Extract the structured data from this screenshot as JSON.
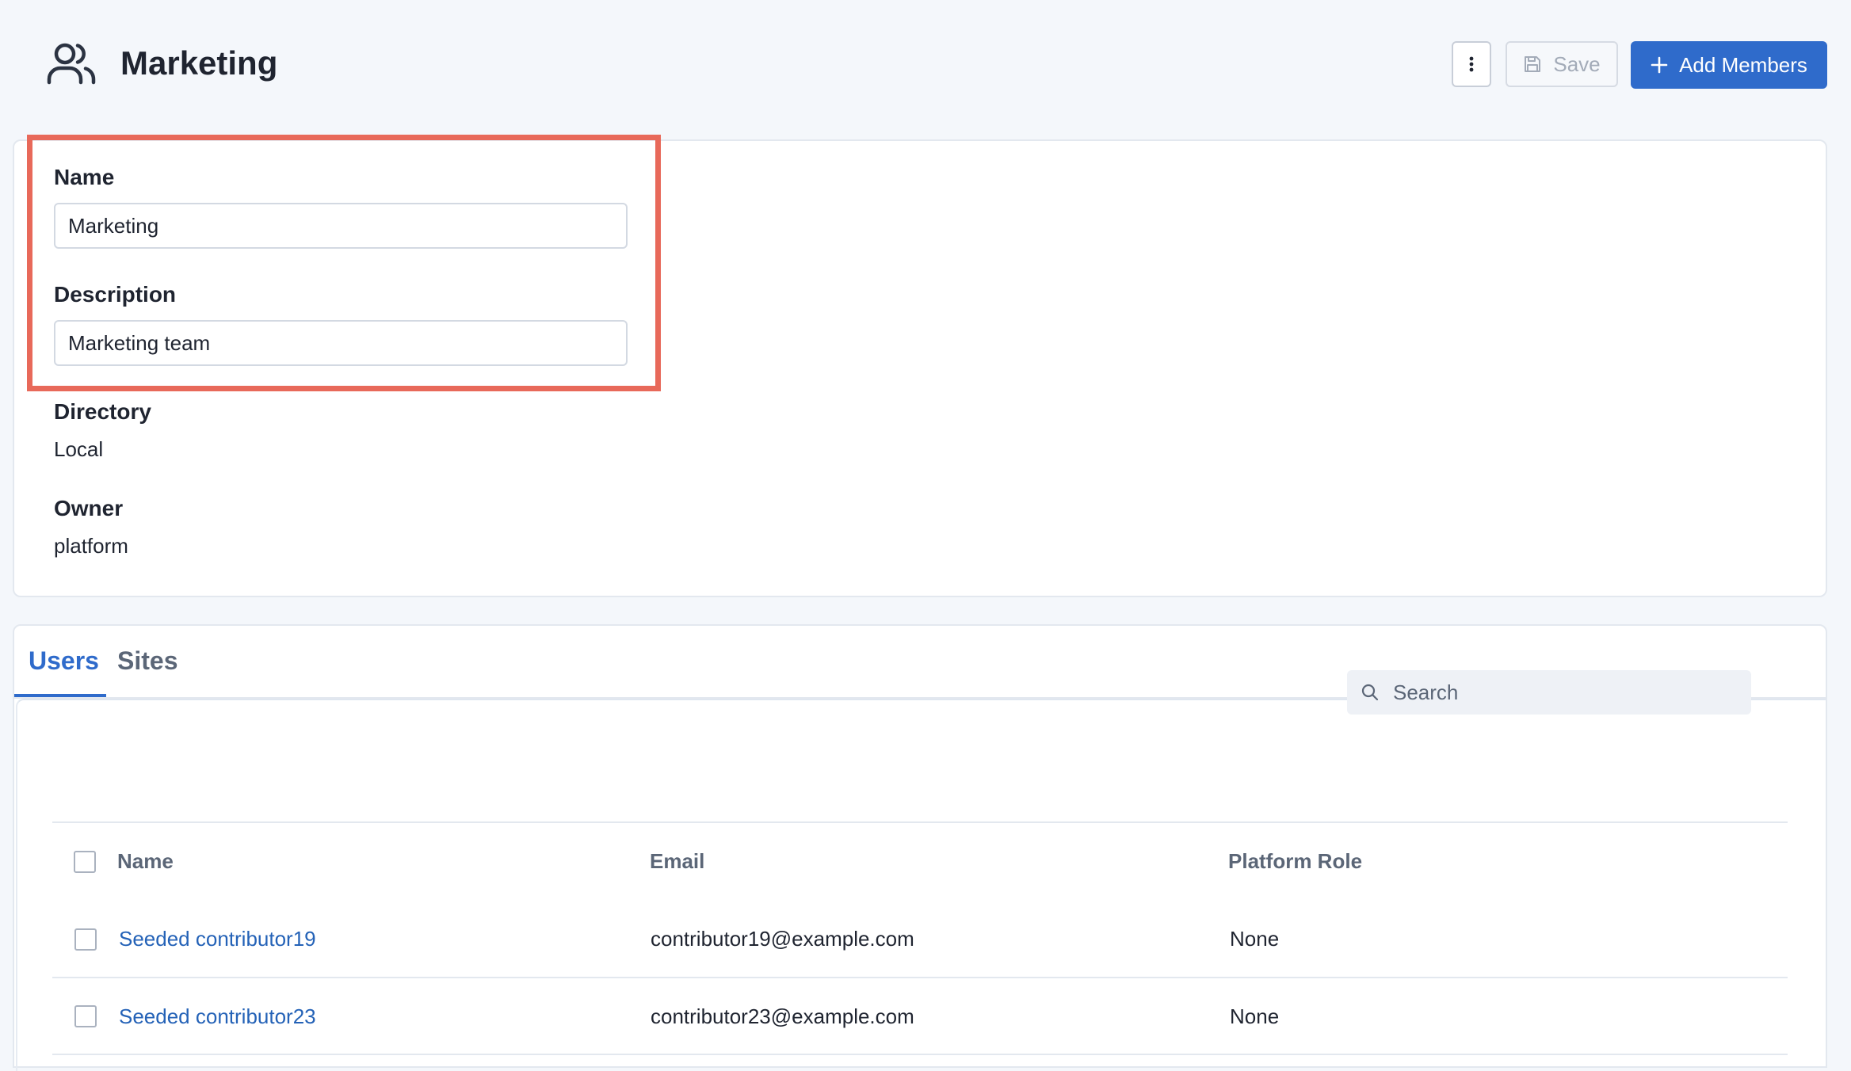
{
  "header": {
    "title": "Marketing",
    "icon": "users-group-icon",
    "more_icon": "vertical-ellipsis-icon",
    "save_label": "Save",
    "save_icon": "floppy-disk-icon",
    "add_members_label": "Add Members",
    "add_icon": "plus-icon"
  },
  "details": {
    "name_label": "Name",
    "name_value": "Marketing",
    "description_label": "Description",
    "description_value": "Marketing team",
    "directory_label": "Directory",
    "directory_value": "Local",
    "owner_label": "Owner",
    "owner_value": "platform"
  },
  "tabs": [
    {
      "label": "Users",
      "active": true
    },
    {
      "label": "Sites",
      "active": false
    }
  ],
  "search": {
    "placeholder": "Search",
    "icon": "search-icon"
  },
  "table": {
    "columns": [
      "Name",
      "Email",
      "Platform Role"
    ],
    "rows": [
      {
        "name": "Seeded contributor19",
        "email": "contributor19@example.com",
        "role": "None"
      },
      {
        "name": "Seeded contributor23",
        "email": "contributor23@example.com",
        "role": "None"
      }
    ]
  },
  "colors": {
    "accent": "#2f6bcb",
    "highlight": "#e8695a",
    "background": "#f4f7fb"
  }
}
